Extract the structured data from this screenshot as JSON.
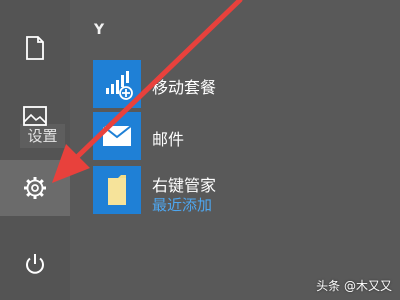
{
  "start_menu": {
    "section_letter": "Y",
    "tooltip": "设置",
    "rail": [
      {
        "icon": "document-icon",
        "label": ""
      },
      {
        "icon": "picture-icon",
        "label": ""
      },
      {
        "icon": "gear-icon",
        "label": "设置",
        "selected": true
      },
      {
        "icon": "power-icon",
        "label": ""
      }
    ],
    "apps": [
      {
        "name": "移动套餐",
        "icon": "signal-plus-icon",
        "subtitle": ""
      },
      {
        "name": "邮件",
        "icon": "mail-icon",
        "subtitle": ""
      },
      {
        "name": "右键管家",
        "icon": "folder-icon",
        "subtitle": "最近添加"
      }
    ]
  },
  "colors": {
    "background": "#595959",
    "tile_blue": "#1f80d6",
    "accent_text": "#4ea6ef",
    "arrow_red": "#e8413c"
  },
  "watermark": "头条 @木又又"
}
